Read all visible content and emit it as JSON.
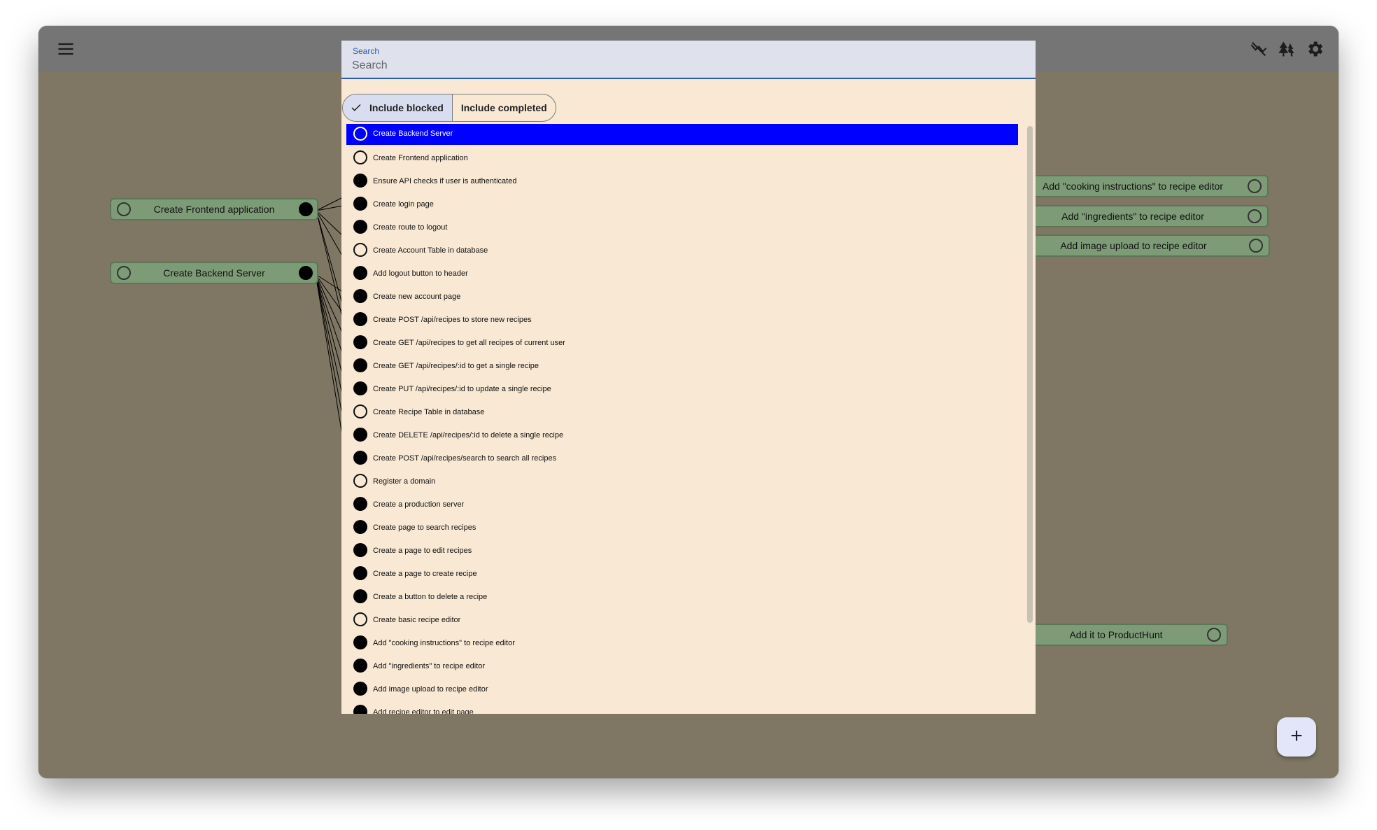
{
  "colors": {
    "canvas": "#7f7764",
    "topbar": "#757575",
    "node_fill": "#7e9b77",
    "dialog_bg": "#f8e8d4",
    "selected_row": "#0000ff",
    "search_accent": "#2a5fa8"
  },
  "topbar": {
    "menu_icon": "hamburger-menu-icon",
    "icons": [
      "flash-off-icon",
      "forest-icon",
      "gear-icon"
    ]
  },
  "nodes": {
    "frontend": "Create Frontend application",
    "backend": "Create Backend Server",
    "cooking": "Add \"cooking instructions\" to recipe editor",
    "ingredients": "Add \"ingredients\" to recipe editor",
    "image_upload": "Add image upload to recipe editor",
    "producthunt": "Add it to ProductHunt"
  },
  "fab": {
    "label": "+"
  },
  "search": {
    "caption": "Search",
    "placeholder": "Search",
    "value": ""
  },
  "filters": {
    "include_blocked": "Include blocked",
    "include_completed": "Include completed",
    "include_blocked_selected": true,
    "include_completed_selected": false
  },
  "results": [
    {
      "label": "Create Backend Server",
      "status": "open",
      "selected": true
    },
    {
      "label": "Create Frontend application",
      "status": "open"
    },
    {
      "label": "Ensure API checks if user is authenticated",
      "status": "blocked"
    },
    {
      "label": "Create login page",
      "status": "blocked"
    },
    {
      "label": "Create route to logout",
      "status": "blocked"
    },
    {
      "label": "Create Account Table in database",
      "status": "open"
    },
    {
      "label": "Add logout button to header",
      "status": "blocked"
    },
    {
      "label": "Create new account page",
      "status": "blocked"
    },
    {
      "label": "Create POST /api/recipes to store new recipes",
      "status": "blocked"
    },
    {
      "label": "Create GET /api/recipes to get all recipes of current user",
      "status": "blocked"
    },
    {
      "label": "Create GET /api/recipes/:id to get a single recipe",
      "status": "blocked"
    },
    {
      "label": "Create PUT /api/recipes/:id to update a single recipe",
      "status": "blocked"
    },
    {
      "label": "Create Recipe Table in database",
      "status": "open"
    },
    {
      "label": "Create DELETE /api/recipes/:id to delete a single recipe",
      "status": "blocked"
    },
    {
      "label": "Create POST /api/recipes/search to search all recipes",
      "status": "blocked"
    },
    {
      "label": "Register a domain",
      "status": "open"
    },
    {
      "label": "Create a production server",
      "status": "blocked"
    },
    {
      "label": "Create page to search recipes",
      "status": "blocked"
    },
    {
      "label": "Create a page to edit recipes",
      "status": "blocked"
    },
    {
      "label": "Create a page to create recipe",
      "status": "blocked"
    },
    {
      "label": "Create a button to delete a recipe",
      "status": "blocked"
    },
    {
      "label": "Create basic recipe editor",
      "status": "open"
    },
    {
      "label": "Add \"cooking instructions\" to recipe editor",
      "status": "blocked"
    },
    {
      "label": "Add \"ingredients\" to recipe editor",
      "status": "blocked"
    },
    {
      "label": "Add image upload to recipe editor",
      "status": "blocked"
    },
    {
      "label": "Add recipe editor to edit page",
      "status": "blocked"
    }
  ]
}
